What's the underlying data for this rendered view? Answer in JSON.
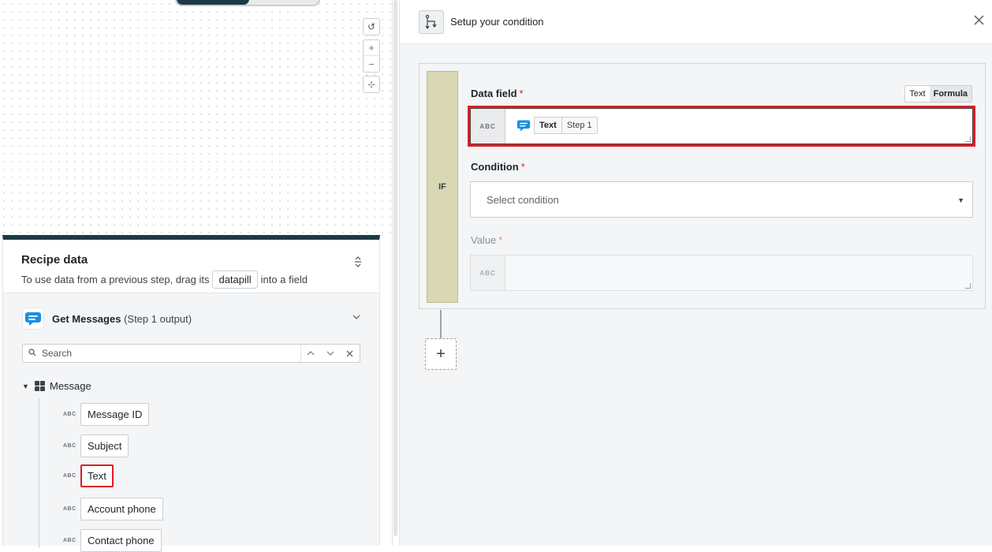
{
  "canvas": {
    "controls": {
      "reset": "↺",
      "zoom_in": "+",
      "zoom_out": "−",
      "fit": "⊹"
    }
  },
  "recipe_data": {
    "title": "Recipe data",
    "subtitle_before": "To use data from a previous step, drag its",
    "subtitle_pill": "datapill",
    "subtitle_after": "into a field",
    "step": {
      "name": "Get Messages",
      "output": "(Step 1 output)"
    },
    "search": {
      "placeholder": "Search"
    },
    "tree": {
      "root": "Message",
      "fields": [
        {
          "type": "ABC",
          "label": "Message ID",
          "highlighted": false
        },
        {
          "type": "ABC",
          "label": "Subject",
          "highlighted": false
        },
        {
          "type": "ABC",
          "label": "Text",
          "highlighted": true
        },
        {
          "type": "ABC",
          "label": "Account phone",
          "highlighted": false
        },
        {
          "type": "ABC",
          "label": "Contact phone",
          "highlighted": false
        }
      ]
    }
  },
  "condition_panel": {
    "title": "Setup your condition",
    "if_label": "IF",
    "data_field": {
      "label": "Data field",
      "required_mark": "*",
      "mode_text": "Text",
      "mode_formula": "Formula",
      "type": "ABC",
      "pill_name": "Text",
      "pill_step": "Step 1"
    },
    "condition": {
      "label": "Condition",
      "required_mark": "*",
      "placeholder": "Select condition"
    },
    "value": {
      "label": "Value",
      "required_mark": "*",
      "type": "ABC"
    },
    "add_step": "+"
  },
  "colors": {
    "brand_dark": "#1d3a44",
    "highlight_red": "#e21b23",
    "if_strip": "#d9d8b4",
    "app_icon_blue": "#1a8fe3"
  }
}
